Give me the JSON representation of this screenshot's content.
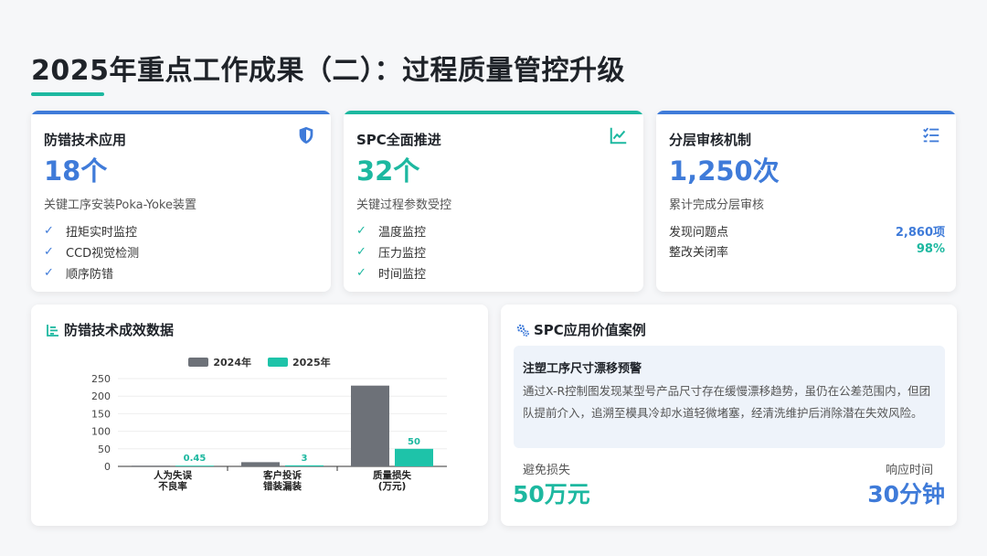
{
  "page": {
    "title": "2025年重点工作成果（二）：过程质量管控升级"
  },
  "colors": {
    "blue": "#3f7bd9",
    "teal": "#1db8a0",
    "gray_bar": "#6d7178",
    "teal_bar": "#1ec3a9"
  },
  "cards": [
    {
      "title": "防错技术应用",
      "icon": "shield-icon",
      "value": "18个",
      "desc": "关键工序安装Poka-Yoke装置",
      "items": [
        "扭矩实时监控",
        "CCD视觉检测",
        "顺序防错"
      ]
    },
    {
      "title": "SPC全面推进",
      "icon": "line-chart-icon",
      "value": "32个",
      "desc": "关键过程参数受控",
      "items": [
        "温度监控",
        "压力监控",
        "时间监控"
      ]
    },
    {
      "title": "分层审核机制",
      "icon": "checklist-icon",
      "value": "1,250次",
      "desc": "累计完成分层审核",
      "rows": [
        {
          "label": "发现问题点",
          "value": "2,860项"
        },
        {
          "label": "整改关闭率",
          "value": "98%"
        }
      ]
    }
  ],
  "chart_section": {
    "title": "防错技术成效数据",
    "icon": "bar-list-icon"
  },
  "chart_data": {
    "type": "bar",
    "categories": [
      [
        "人为失误",
        "不良率"
      ],
      [
        "客户投诉",
        "错装漏装"
      ],
      [
        "质量损失",
        "(万元)"
      ]
    ],
    "series": [
      {
        "name": "2024年",
        "values": [
          0,
          12,
          230
        ]
      },
      {
        "name": "2025年",
        "values": [
          0.45,
          3,
          50
        ]
      }
    ],
    "data_labels_2025": [
      "0.45",
      "3",
      "50"
    ],
    "ylim": [
      0,
      250
    ],
    "yticks": [
      0,
      50,
      100,
      150,
      200,
      250
    ],
    "grid": true,
    "legend_position": "top-center"
  },
  "case_section": {
    "title": "SPC应用价值案例",
    "icon": "gears-icon",
    "case_title": "注塑工序尺寸漂移预警",
    "case_text": "通过X-R控制图发现某型号产品尺寸存在缓慢漂移趋势，虽仍在公差范围内，但团队提前介入，追溯至模具冷却水道轻微堵塞，经清洗维护后消除潜在失效风险。",
    "metrics": [
      {
        "label": "避免损失",
        "value": "50万元"
      },
      {
        "label": "响应时间",
        "value": "30分钟"
      }
    ]
  }
}
